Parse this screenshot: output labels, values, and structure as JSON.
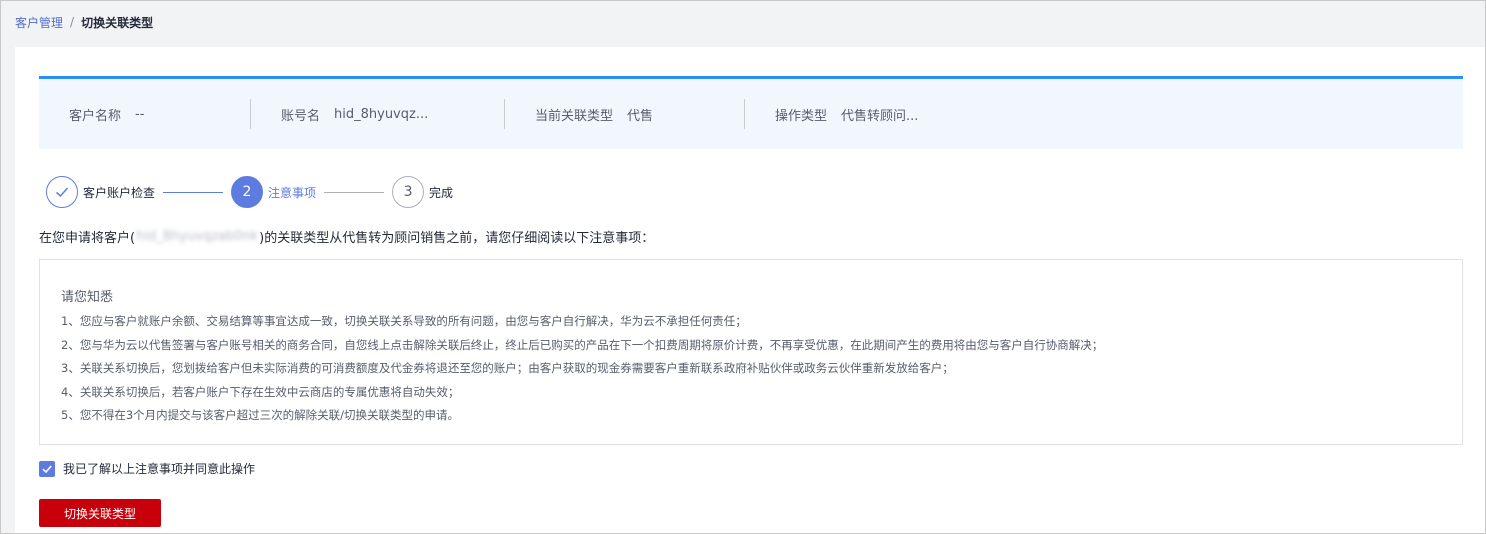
{
  "breadcrumb": {
    "parent": "客户管理",
    "separator": "/",
    "current": "切换关联类型"
  },
  "info": {
    "customer_name_label": "客户名称",
    "customer_name_value": "--",
    "account_label": "账号名",
    "account_value": "hid_8hyuvqz...",
    "current_type_label": "当前关联类型",
    "current_type_value": "代售",
    "operation_label": "操作类型",
    "operation_value": "代售转顾问..."
  },
  "steps": [
    {
      "label": "客户账户检查",
      "state": "done"
    },
    {
      "number": "2",
      "label": "注意事项",
      "state": "active"
    },
    {
      "number": "3",
      "label": "完成",
      "state": "todo"
    }
  ],
  "intro": {
    "prefix": "在您申请将客户(",
    "masked_account": "hid_8hyuvqzab0nk",
    "suffix": ")的关联类型从代售转为顾问销售之前，请您仔细阅读以下注意事项："
  },
  "notice": {
    "title": "请您知悉",
    "items": [
      "1、您应与客户就账户余额、交易结算等事宜达成一致，切换关联关系导致的所有问题，由您与客户自行解决，华为云不承担任何责任；",
      "2、您与华为云以代售签署与客户账号相关的商务合同，自您线上点击解除关联后终止，终止后已购买的产品在下一个扣费周期将原价计费，不再享受优惠，在此期间产生的费用将由您与客户自行协商解决；",
      "3、关联关系切换后，您划拨给客户但未实际消费的可消费额度及代金券将退还至您的账户；由客户获取的现金券需要客户重新联系政府补贴伙伴或政务云伙伴重新发放给客户；",
      "4、关联关系切换后，若客户账户下存在生效中云商店的专属优惠将自动失效；",
      "5、您不得在3个月内提交与该客户超过三次的解除关联/切换关联类型的申请。"
    ]
  },
  "agreement": {
    "checked": true,
    "label": "我已了解以上注意事项并同意此操作"
  },
  "submit_label": "切换关联类型",
  "colors": {
    "accent": "#5e7ce0",
    "info_bar_top": "#2a8ff7",
    "primary_button": "#c7000b"
  }
}
